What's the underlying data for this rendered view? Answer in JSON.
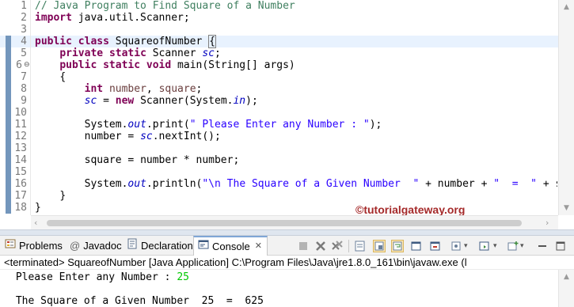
{
  "editor": {
    "lines": [
      {
        "num": "1"
      },
      {
        "num": "2"
      },
      {
        "num": "3"
      },
      {
        "num": "4"
      },
      {
        "num": "5"
      },
      {
        "num": "6"
      },
      {
        "num": "7"
      },
      {
        "num": "8"
      },
      {
        "num": "9"
      },
      {
        "num": "10"
      },
      {
        "num": "11"
      },
      {
        "num": "12"
      },
      {
        "num": "13"
      },
      {
        "num": "14"
      },
      {
        "num": "15"
      },
      {
        "num": "16"
      },
      {
        "num": "17"
      },
      {
        "num": "18"
      }
    ],
    "code": {
      "l1": "// Java Program to Find Square of a Number",
      "l2_kw": "import",
      "l2_rest": " java.util.Scanner;",
      "l4_kw1": "public",
      "l4_kw2": "class",
      "l4_name": " SquareofNumber ",
      "l4_brace": "{",
      "l5_kw1": "private",
      "l5_kw2": "static",
      "l5_type": " Scanner ",
      "l5_field": "sc",
      "l5_end": ";",
      "l6_kw1": "public",
      "l6_kw2": "static",
      "l6_kw3": "void",
      "l6_rest": " main(String[] args)",
      "l7": "{",
      "l8_kw": "int",
      "l8_v1": "number",
      "l8_sep": ", ",
      "l8_v2": "square",
      "l8_end": ";",
      "l9_field": "sc",
      "l9_eq": " = ",
      "l9_kw": "new",
      "l9_mid": " Scanner(System.",
      "l9_in": "in",
      "l9_end": ");",
      "l11_a": "System.",
      "l11_out": "out",
      "l11_b": ".print(",
      "l11_str": "\" Please Enter any Number : \"",
      "l11_end": ");",
      "l12_a": "number = ",
      "l12_field": "sc",
      "l12_b": ".nextInt();",
      "l14": "square = number * number;",
      "l16_a": "System.",
      "l16_out": "out",
      "l16_b": ".println(",
      "l16_s1": "\"\\n The Square of a Given Number  \"",
      "l16_c": " + number + ",
      "l16_s2": "\"  =  \"",
      "l16_d": " + square);",
      "l17": "}",
      "l18": "}"
    },
    "watermark": "©tutorialgateway.org"
  },
  "panel": {
    "tabs": [
      {
        "label": "Problems",
        "icon": "problems-icon"
      },
      {
        "label": "Javadoc",
        "icon": "javadoc-icon"
      },
      {
        "label": "Declaration",
        "icon": "declaration-icon"
      },
      {
        "label": "Console",
        "icon": "console-icon",
        "active": true
      }
    ],
    "javadoc_at": "@",
    "close_glyph": "✕",
    "status": "<terminated> SquareofNumber [Java Application] C:\\Program Files\\Java\\jre1.8.0_161\\bin\\javaw.exe (l",
    "output": {
      "line1_prompt": " Please Enter any Number : ",
      "line1_input": "25",
      "line2": "",
      "line3": " The Square of a Given Number  25  =  625"
    }
  },
  "colors": {
    "keyword": "#7f0055",
    "comment": "#3f7f5f",
    "string": "#2a00ff",
    "field": "#0000c0",
    "variable": "#6a3e3e",
    "console_input": "#00c800",
    "watermark": "#a52a2a"
  }
}
